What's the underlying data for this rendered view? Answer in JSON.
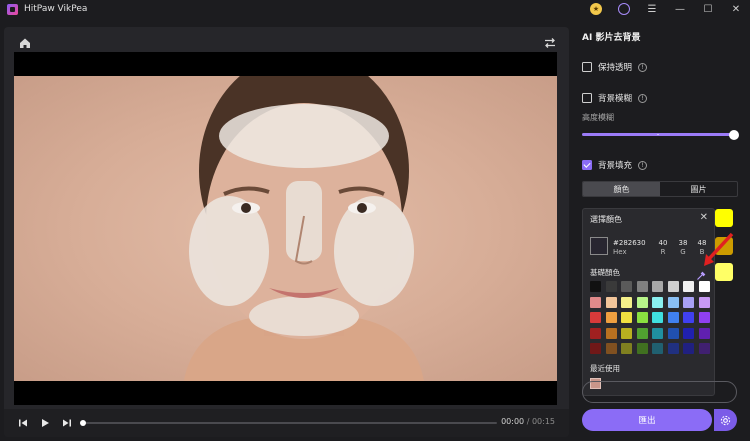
{
  "app": {
    "title": "HitPaw VikPea"
  },
  "titlebar": {
    "icons": [
      "premium-icon",
      "user-icon",
      "menu-icon",
      "minimize-icon",
      "maximize-icon",
      "close-icon"
    ]
  },
  "player": {
    "current_time": "00:00",
    "total_time": "/ 00:15"
  },
  "panel": {
    "title": "AI 影片去背景",
    "keep_transparent": "保持透明",
    "blur_background": "背景模糊",
    "blur_strength_label": "高度模糊",
    "blur_level": 1.0,
    "fill_background": "背景填充",
    "tabs": [
      {
        "label": "顏色"
      },
      {
        "label": "圖片"
      }
    ],
    "side_swatches": [
      "#ffff00",
      "#cc9b00",
      "#ffff66"
    ],
    "export_label": "匯出"
  },
  "color_picker": {
    "title": "選擇顏色",
    "current_hex": "#282630",
    "hex_label": "Hex",
    "r": "40",
    "g": "38",
    "b": "48",
    "r_label": "R",
    "g_label": "G",
    "b_label": "B",
    "basic_label": "基礎顏色",
    "recent_label": "最近使用",
    "recent_color": "#c8968a",
    "basic_colors": [
      "#111111",
      "#3a3a3a",
      "#5a5a5a",
      "#808080",
      "#a8a8a8",
      "#d0d0d0",
      "#f0f0f0",
      "#ffffff",
      "#e08a8a",
      "#f2c59a",
      "#f5f08a",
      "#b8f58a",
      "#8af0f0",
      "#8ac0f5",
      "#a8a0f5",
      "#c89af5",
      "#d83a3a",
      "#f0a040",
      "#f0e040",
      "#8ae040",
      "#40e0e0",
      "#4080f0",
      "#4040f0",
      "#9040f0",
      "#a02020",
      "#b87020",
      "#b8b020",
      "#50a030",
      "#2090a0",
      "#2050b0",
      "#2020b0",
      "#6020b0",
      "#701818",
      "#805020",
      "#808020",
      "#407020",
      "#206070",
      "#203080",
      "#202080",
      "#402070"
    ]
  }
}
